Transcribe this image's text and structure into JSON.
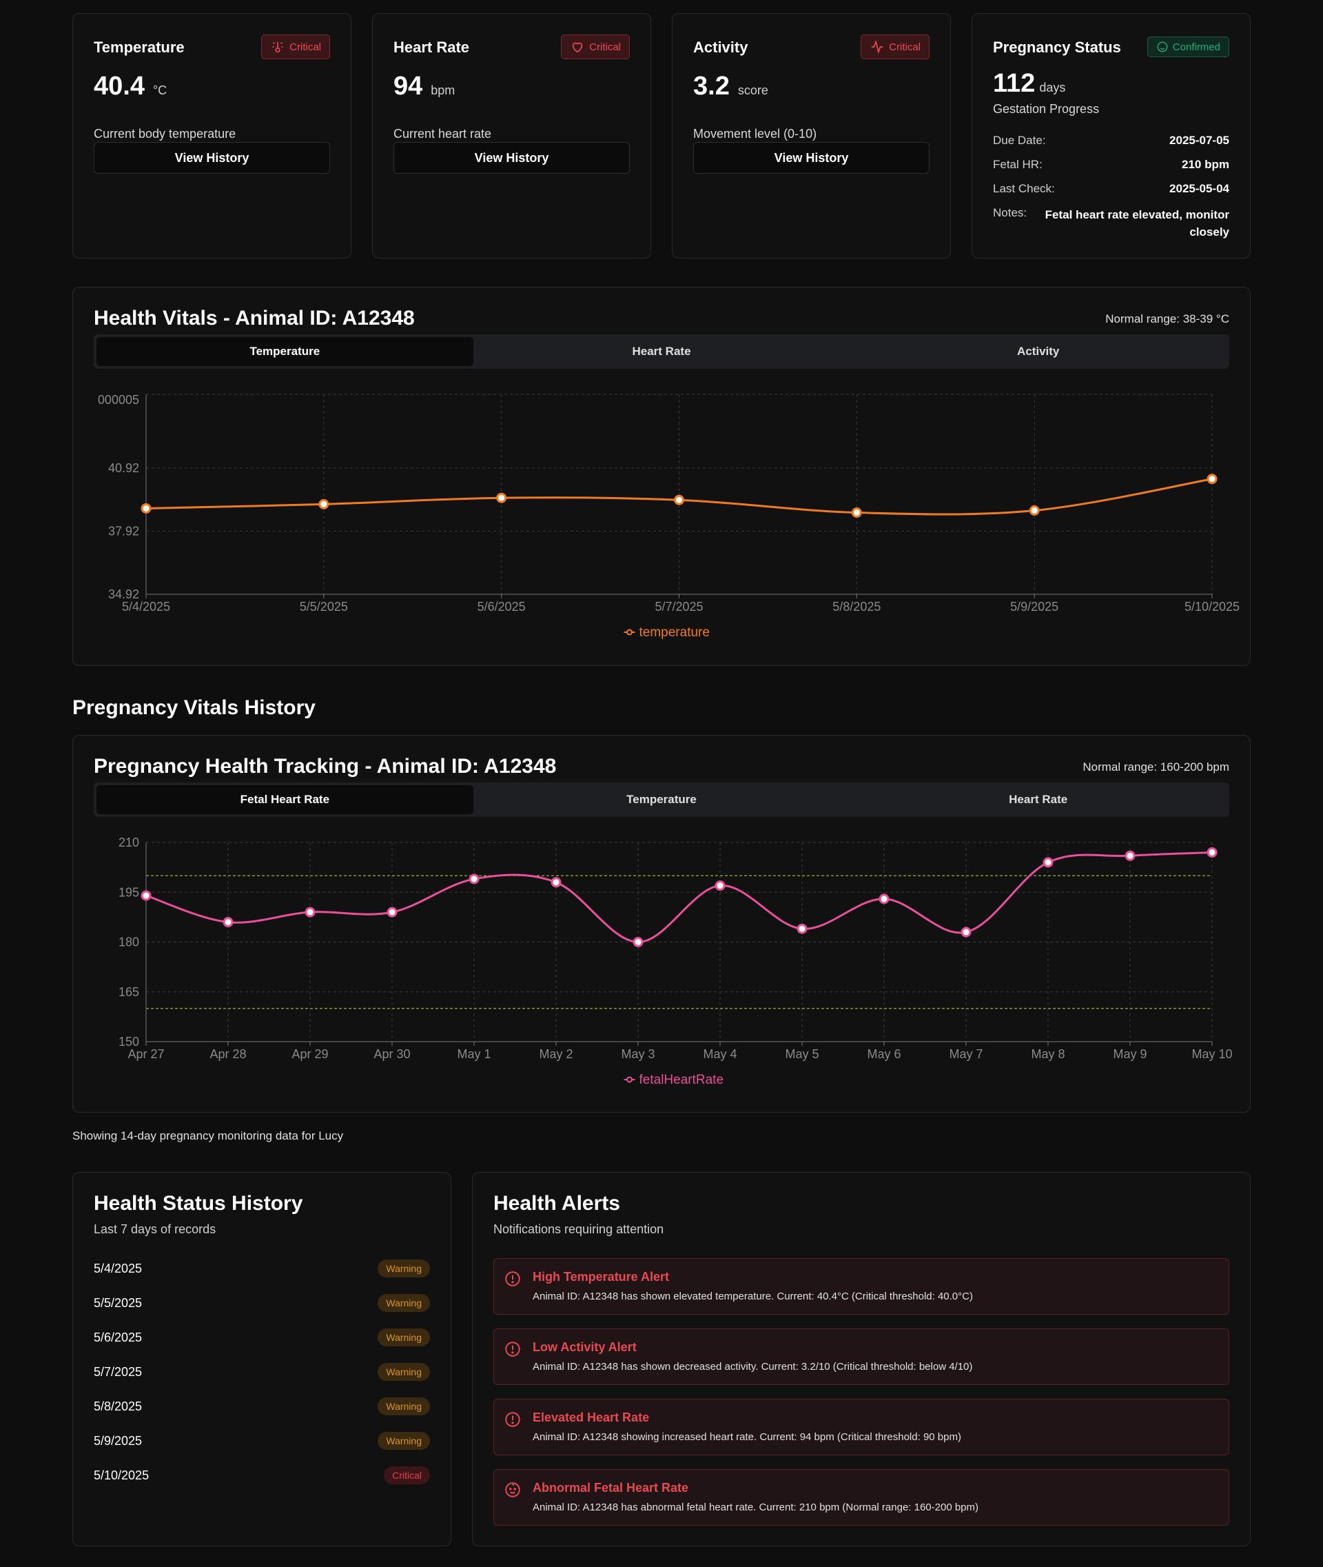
{
  "stats": [
    {
      "title": "Temperature",
      "badge": "Critical",
      "badge_icon": "thermometer-icon",
      "value": "40.4",
      "unit": "°C",
      "desc": "Current body temperature",
      "button": "View History"
    },
    {
      "title": "Heart Rate",
      "badge": "Critical",
      "badge_icon": "heart-icon",
      "value": "94",
      "unit": "bpm",
      "desc": "Current heart rate",
      "button": "View History"
    },
    {
      "title": "Activity",
      "badge": "Critical",
      "badge_icon": "activity-icon",
      "value": "3.2",
      "unit": "score",
      "desc": "Movement level (0-10)",
      "button": "View History"
    }
  ],
  "pregnancy": {
    "title": "Pregnancy Status",
    "badge": "Confirmed",
    "days_value": "112",
    "days_unit": "days",
    "progress_label": "Gestation Progress",
    "rows": [
      {
        "k": "Due Date:",
        "v": "2025-07-05"
      },
      {
        "k": "Fetal HR:",
        "v": "210 bpm"
      },
      {
        "k": "Last Check:",
        "v": "2025-05-04"
      },
      {
        "k": "Notes:",
        "v": "Fetal heart rate elevated, monitor closely"
      }
    ]
  },
  "vitals": {
    "title": "Health Vitals - Animal ID: A12348",
    "range_note": "Normal range: 38-39 °C",
    "tabs": [
      "Temperature",
      "Heart Rate",
      "Activity"
    ],
    "active_tab": 0
  },
  "section_title": "Pregnancy Vitals History",
  "pregnancy_chart": {
    "title": "Pregnancy Health Tracking - Animal ID: A12348",
    "range_note": "Normal range: 160-200 bpm",
    "tabs": [
      "Fetal Heart Rate",
      "Temperature",
      "Heart Rate"
    ],
    "active_tab": 0
  },
  "caption": "Showing 14-day pregnancy monitoring data for Lucy",
  "history": {
    "title": "Health Status History",
    "subtitle": "Last 7 days of records",
    "rows": [
      {
        "date": "5/4/2025",
        "status": "Warning"
      },
      {
        "date": "5/5/2025",
        "status": "Warning"
      },
      {
        "date": "5/6/2025",
        "status": "Warning"
      },
      {
        "date": "5/7/2025",
        "status": "Warning"
      },
      {
        "date": "5/8/2025",
        "status": "Warning"
      },
      {
        "date": "5/9/2025",
        "status": "Warning"
      },
      {
        "date": "5/10/2025",
        "status": "Critical"
      }
    ]
  },
  "alerts": {
    "title": "Health Alerts",
    "subtitle": "Notifications requiring attention",
    "items": [
      {
        "title": "High Temperature Alert",
        "msg": "Animal ID: A12348 has shown elevated temperature. Current: 40.4°C (Critical threshold: 40.0°C)",
        "icon": "alert-circle-icon"
      },
      {
        "title": "Low Activity Alert",
        "msg": "Animal ID: A12348 has shown decreased activity. Current: 3.2/10 (Critical threshold: below 4/10)",
        "icon": "alert-circle-icon"
      },
      {
        "title": "Elevated Heart Rate",
        "msg": "Animal ID: A12348 showing increased heart rate. Current: 94 bpm (Critical threshold: 90 bpm)",
        "icon": "alert-circle-icon"
      },
      {
        "title": "Abnormal Fetal Heart Rate",
        "msg": "Animal ID: A12348 has abnormal fetal heart rate. Current: 210 bpm (Normal range: 160-200 bpm)",
        "icon": "baby-icon"
      }
    ]
  },
  "colors": {
    "temperature": "#f07c22",
    "fetal": "#e8509a",
    "threshold": "#a8c43a",
    "critical": "#ef4a52",
    "warning": "#d99428"
  },
  "chart_data": [
    {
      "type": "line",
      "x": [
        "5/4/2025",
        "5/5/2025",
        "5/6/2025",
        "5/7/2025",
        "5/8/2025",
        "5/9/2025",
        "5/10/2025"
      ],
      "series": [
        {
          "name": "temperature",
          "values": [
            39.0,
            39.2,
            39.5,
            39.4,
            38.8,
            38.9,
            40.4
          ]
        }
      ],
      "y_ticks": [
        "34.92",
        "37.92",
        "40.92",
        "000005"
      ],
      "ylim": [
        34.92,
        44.42
      ],
      "grid": true,
      "legend": "bottom"
    },
    {
      "type": "line",
      "x": [
        "Apr 27",
        "Apr 28",
        "Apr 29",
        "Apr 30",
        "May 1",
        "May 2",
        "May 3",
        "May 4",
        "May 5",
        "May 6",
        "May 7",
        "May 8",
        "May 9",
        "May 10"
      ],
      "series": [
        {
          "name": "fetalHeartRate",
          "values": [
            194,
            186,
            189,
            189,
            199,
            198,
            180,
            197,
            184,
            193,
            183,
            204,
            206,
            207
          ]
        }
      ],
      "y_ticks": [
        "150",
        "165",
        "180",
        "195",
        "210"
      ],
      "ylim": [
        150,
        210
      ],
      "reference_lines": [
        160,
        200
      ],
      "grid": true,
      "legend": "bottom"
    }
  ]
}
